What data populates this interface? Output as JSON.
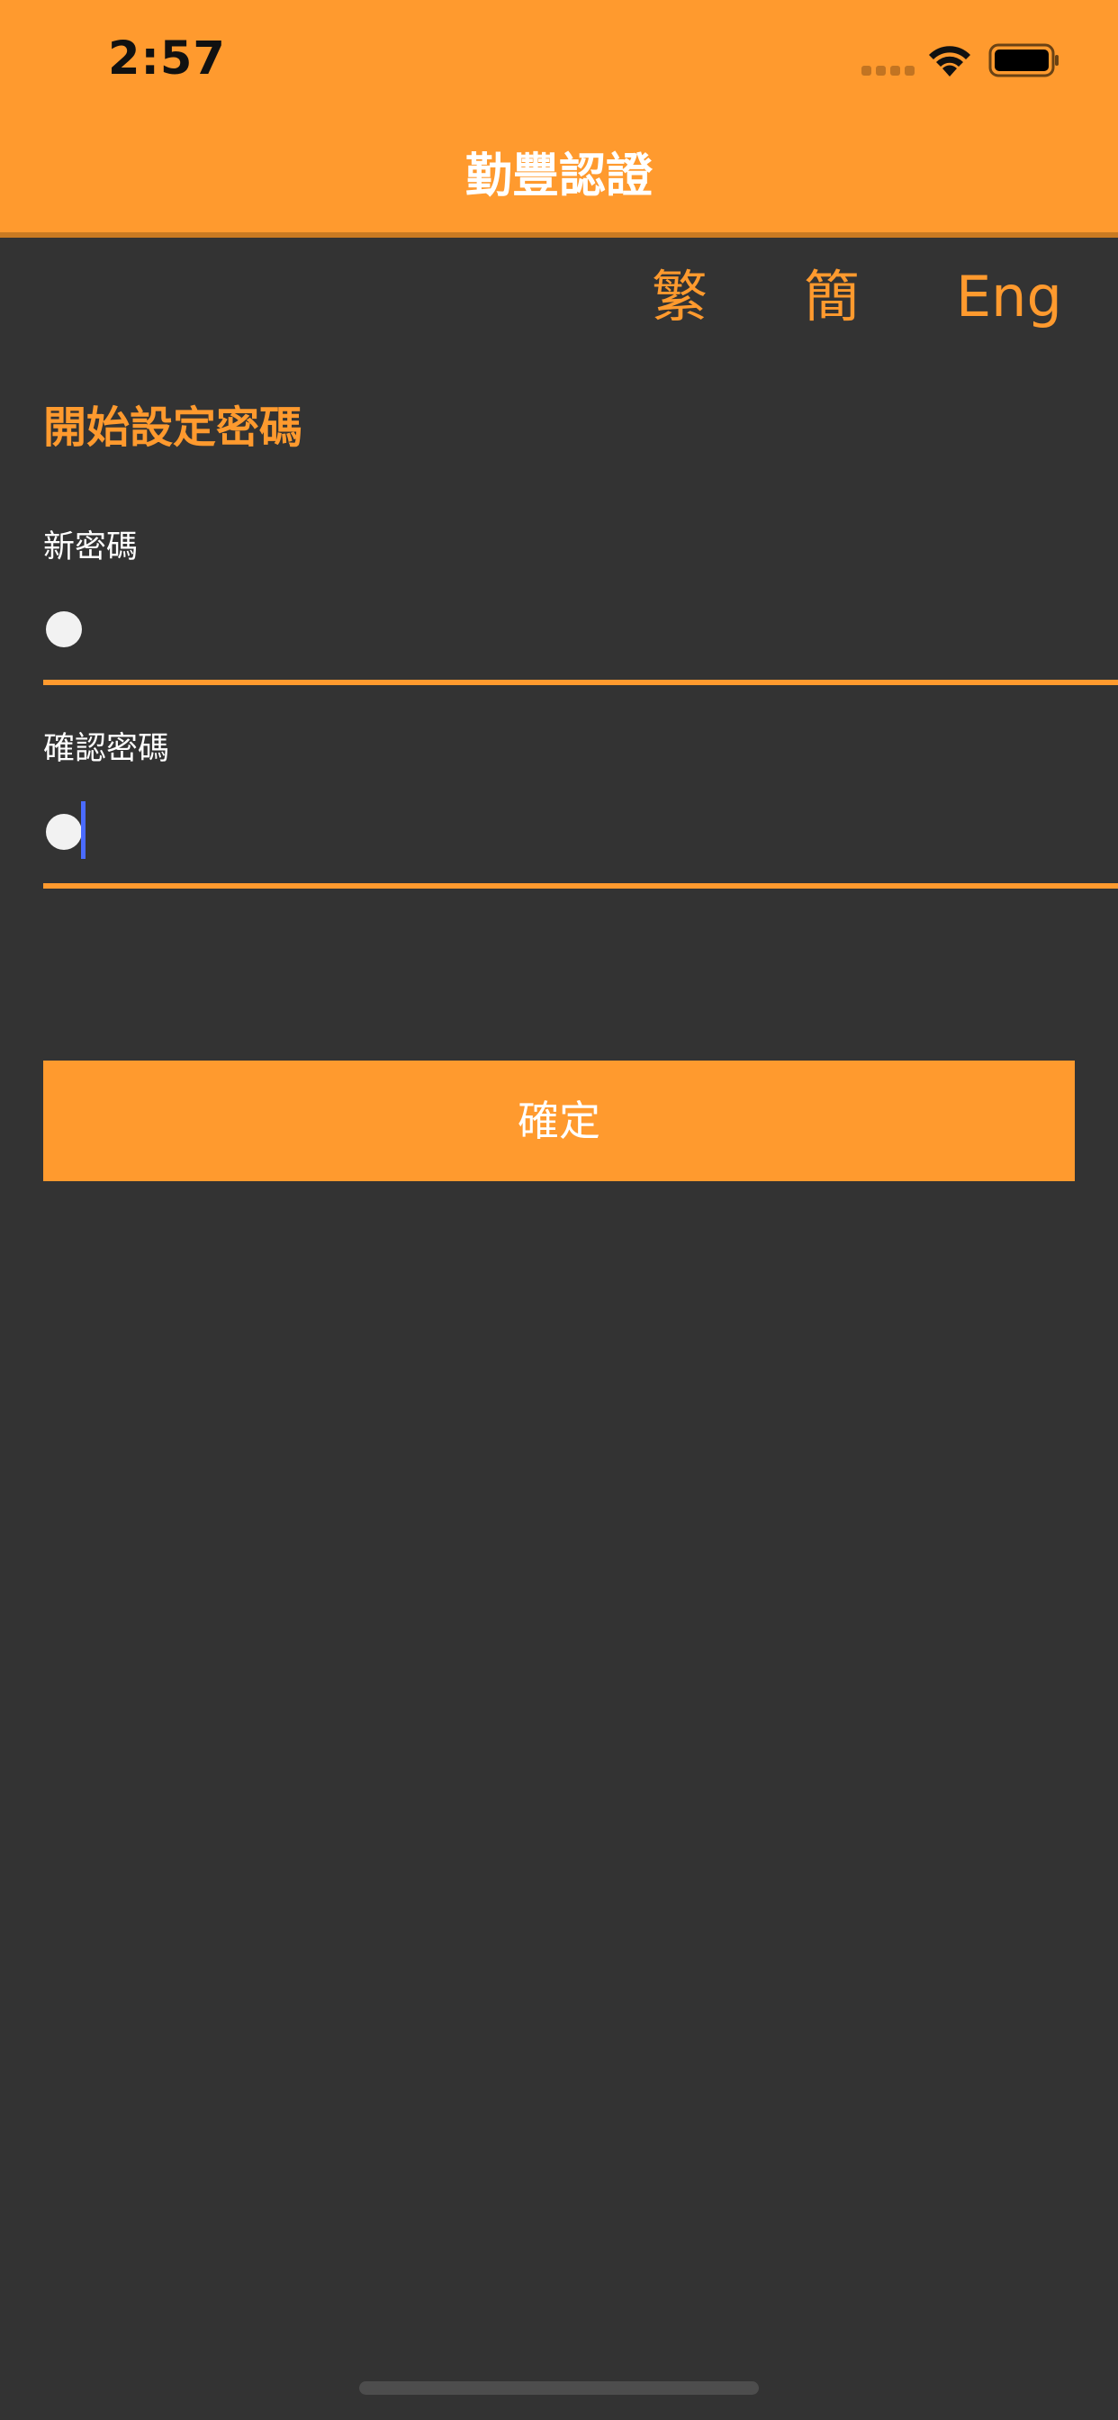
{
  "status_bar": {
    "time": "2:57"
  },
  "nav": {
    "title": "勤豐認證"
  },
  "language": {
    "traditional": "繁",
    "simplified": "簡",
    "english": "Eng"
  },
  "form": {
    "title": "開始設定密碼",
    "new_password": {
      "label": "新密碼",
      "value": "•"
    },
    "confirm_password": {
      "label": "確認密碼",
      "value": "•"
    },
    "submit_label": "確定"
  },
  "colors": {
    "accent": "#ff9a2e",
    "background": "#333333",
    "text": "#ffffff",
    "caret": "#4a6bff"
  },
  "icons": {
    "wifi": "wifi-icon",
    "battery": "battery-icon",
    "signal": "cellular-signal-icon"
  }
}
